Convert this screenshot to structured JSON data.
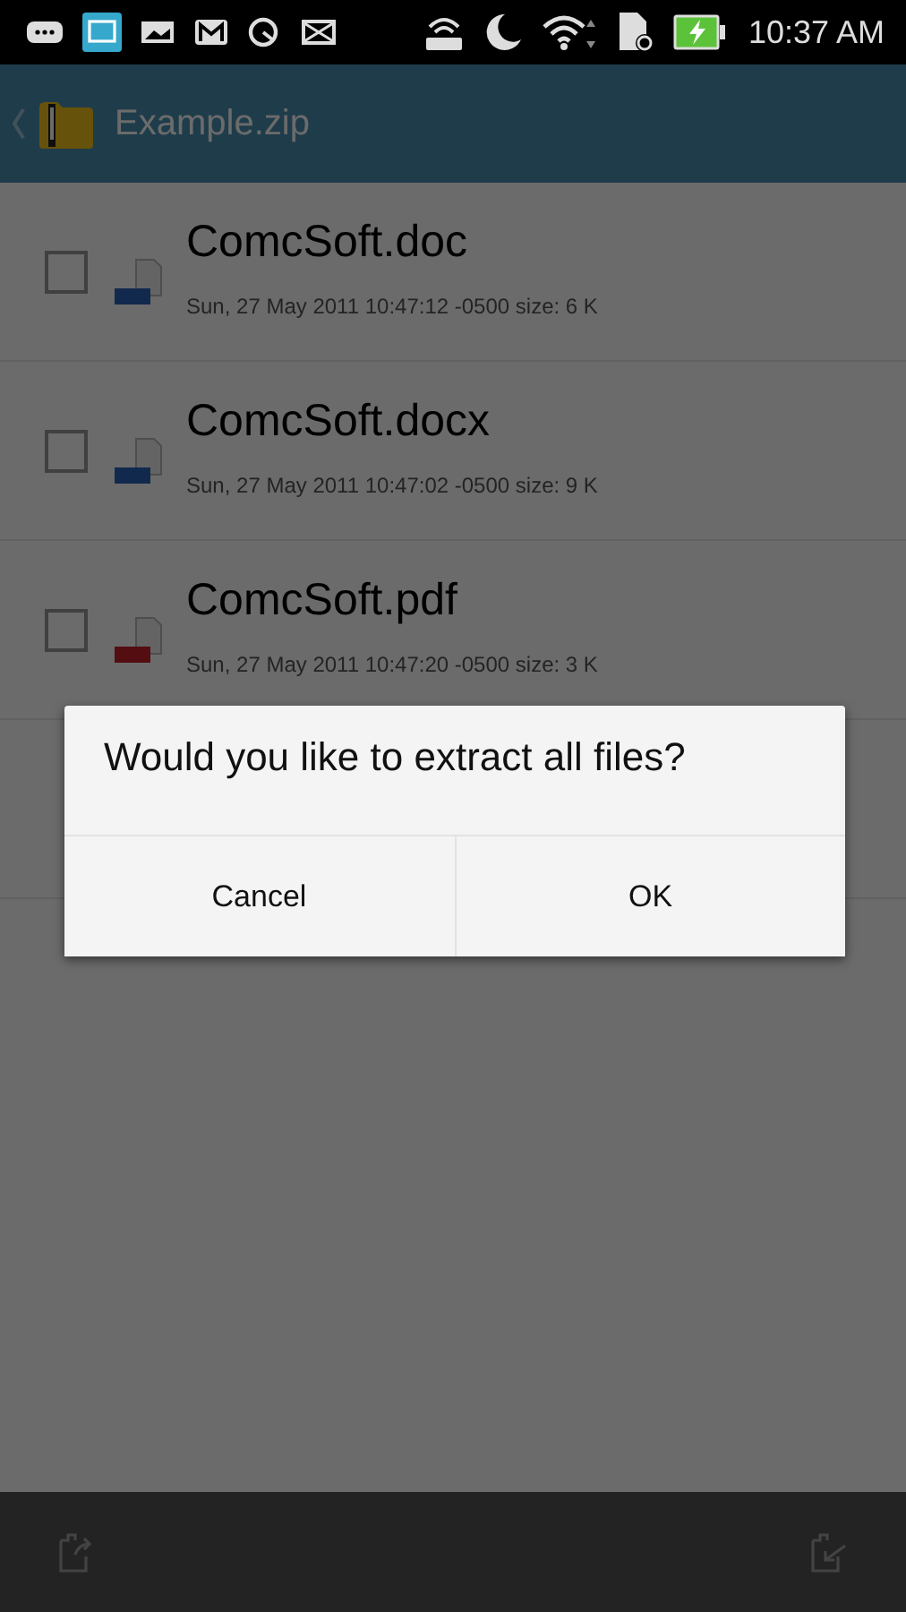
{
  "status_bar": {
    "time": "10:37 AM"
  },
  "app_bar": {
    "title": "Example.zip"
  },
  "files": [
    {
      "kind": "doc",
      "name": "ComcSoft.doc",
      "details": "Sun, 27 May 2011 10:47:12 -0500   size: 6 K",
      "checked": false
    },
    {
      "kind": "doc",
      "name": "ComcSoft.docx",
      "details": "Sun, 27 May 2011 10:47:02 -0500   size: 9 K",
      "checked": false
    },
    {
      "kind": "pdf",
      "name": "ComcSoft.pdf",
      "details": "Sun, 27 May 2011 10:47:20 -0500   size: 3 K",
      "checked": false
    }
  ],
  "dialog": {
    "message": "Would you like to extract all files?",
    "buttons": [
      "Cancel",
      "OK"
    ]
  }
}
